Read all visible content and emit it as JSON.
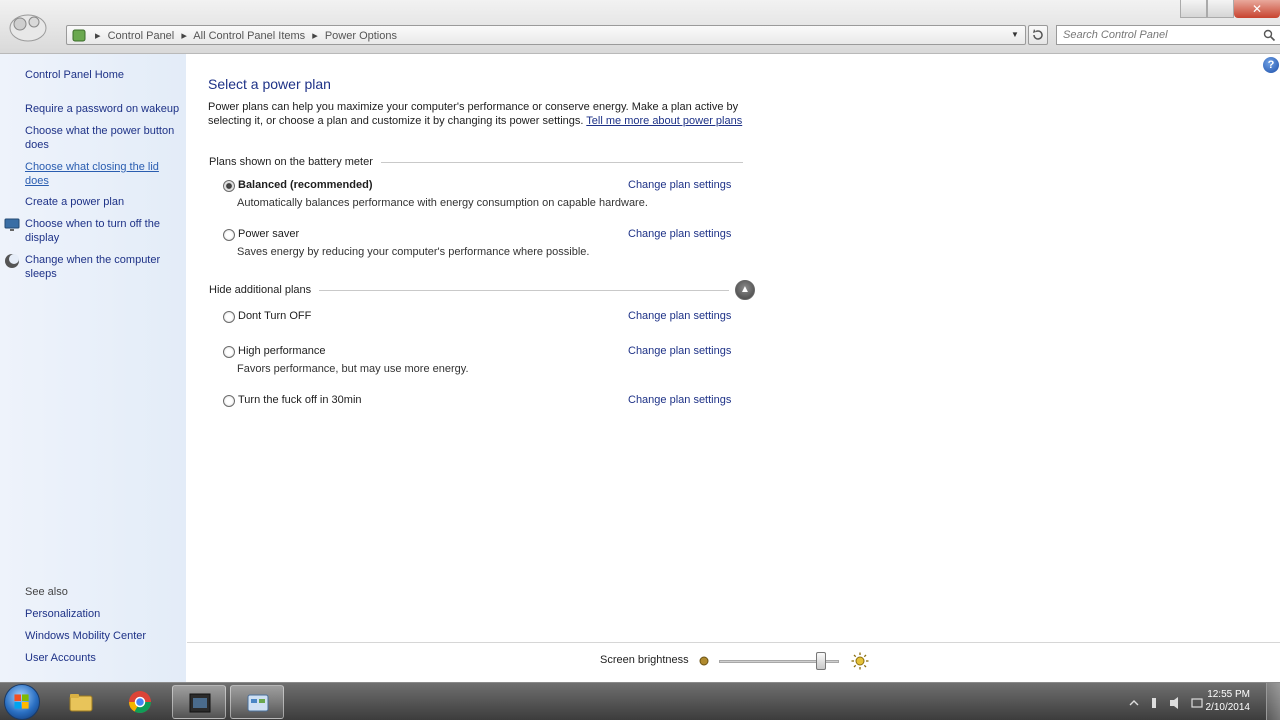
{
  "window": {
    "breadcrumb": [
      "Control Panel",
      "All Control Panel Items",
      "Power Options"
    ],
    "search_placeholder": "Search Control Panel",
    "help_label": "?"
  },
  "sidebar": {
    "home": "Control Panel Home",
    "tasks": [
      {
        "label": "Require a password on wakeup"
      },
      {
        "label": "Choose what the power button does"
      },
      {
        "label": "Choose what closing the lid does"
      },
      {
        "label": "Create a power plan"
      },
      {
        "label": "Choose when to turn off the display"
      },
      {
        "label": "Change when the computer sleeps"
      }
    ],
    "see_also": {
      "title": "See also",
      "items": [
        {
          "label": "Personalization"
        },
        {
          "label": "Windows Mobility Center"
        },
        {
          "label": "User Accounts"
        }
      ]
    }
  },
  "main": {
    "title": "Select a power plan",
    "intro": "Power plans can help you maximize your computer's performance or conserve energy. Make a plan active by selecting it, or choose a plan and customize it by changing its power settings.",
    "intro_link": "Tell me more about power plans",
    "battery_section": "Plans shown on the battery meter",
    "additional_section": "Hide additional plans",
    "plans": [
      {
        "name": "Balanced (recommended)",
        "description": "Automatically balances performance with energy consumption on capable hardware.",
        "link": "Change plan settings",
        "selected": true
      },
      {
        "name": "Power saver",
        "description": "Saves energy by reducing your computer's performance where possible.",
        "link": "Change plan settings",
        "selected": false
      },
      {
        "name": "Dont Turn OFF",
        "description": "",
        "link": "Change plan settings",
        "selected": false
      },
      {
        "name": "High performance",
        "description": "Favors performance, but may use more energy.",
        "link": "Change plan settings",
        "selected": false
      },
      {
        "name": "Turn the fuck off in 30min",
        "description": "",
        "link": "Change plan settings",
        "selected": false
      }
    ]
  },
  "brightness": {
    "label": "Screen brightness",
    "level_percent": 85
  },
  "taskbar": {
    "time": "12:55 PM",
    "date": "2/10/2014"
  },
  "colors": {
    "link": "#1e3287",
    "sidebar_bg": "#e8eff9",
    "taskbar": "#4a4a4a"
  }
}
